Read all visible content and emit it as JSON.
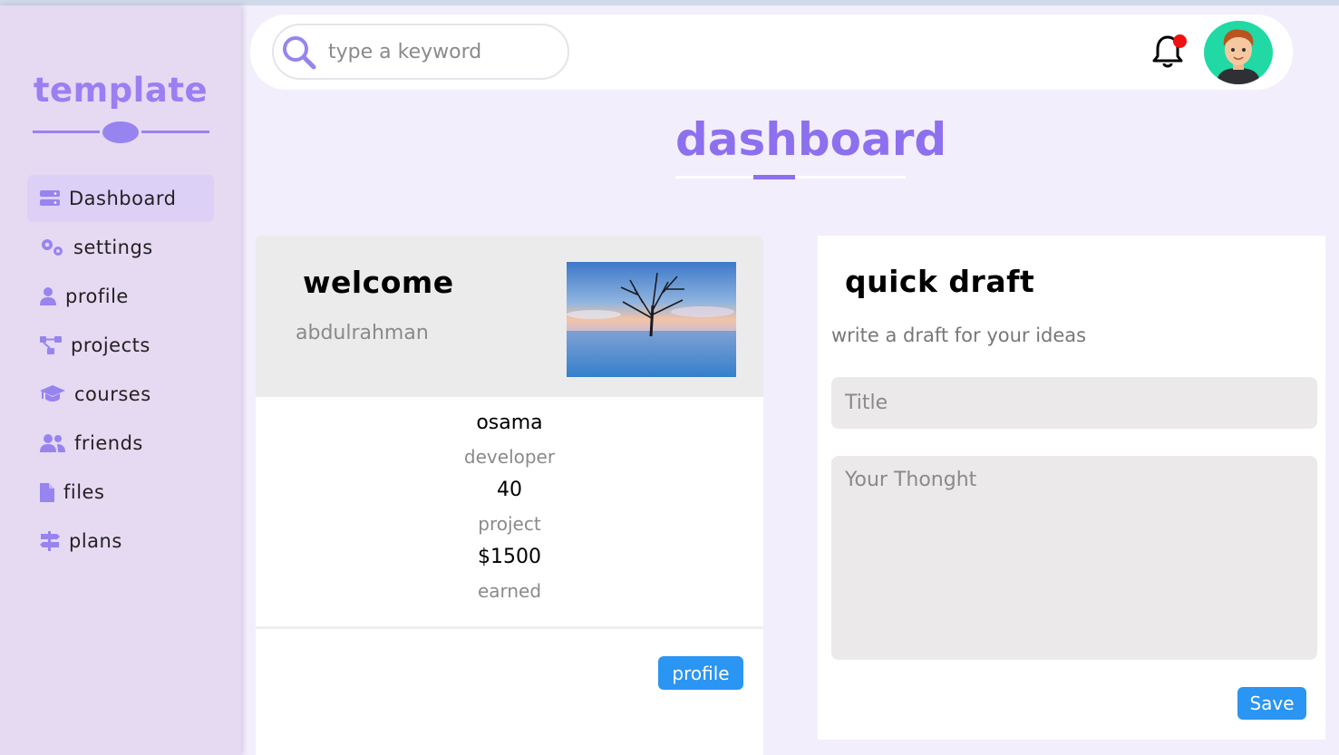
{
  "sidebar": {
    "brand": "template",
    "items": [
      {
        "label": "Dashboard",
        "icon": "server-icon"
      },
      {
        "label": "settings",
        "icon": "gears-icon"
      },
      {
        "label": "profile",
        "icon": "user-icon"
      },
      {
        "label": "projects",
        "icon": "diagram-icon"
      },
      {
        "label": "courses",
        "icon": "graduation-cap-icon"
      },
      {
        "label": "friends",
        "icon": "users-icon"
      },
      {
        "label": "files",
        "icon": "file-icon"
      },
      {
        "label": "plans",
        "icon": "signs-icon"
      }
    ]
  },
  "header": {
    "search_placeholder": "type a keyword",
    "notification_icon": "bell-icon",
    "avatar_icon": "avatar-icon"
  },
  "page": {
    "title": "dashboard"
  },
  "welcome": {
    "title": "welcome",
    "user": "abdulrahman",
    "name": "osama",
    "role": "developer",
    "projects_count": "40",
    "projects_label": "project",
    "earned_value": "$1500",
    "earned_label": "earned",
    "profile_button": "profile"
  },
  "draft": {
    "title": "quick draft",
    "subtitle": "write a draft for your ideas",
    "title_placeholder": "Title",
    "text_placeholder": "Your Thonght",
    "save_button": "Save"
  },
  "colors": {
    "accent": "#8d70ee",
    "sidebar_bg": "#e6d9f2",
    "page_bg": "#f3eefc",
    "button": "#2a95f2",
    "notification_dot": "#ee1111"
  }
}
